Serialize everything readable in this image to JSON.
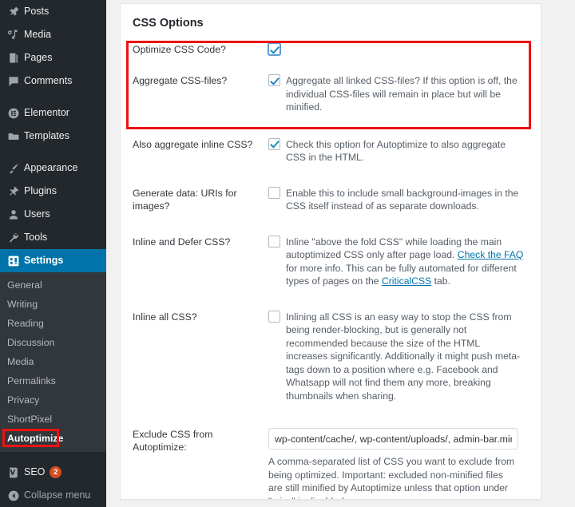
{
  "sidebar": {
    "items": [
      {
        "label": "Posts",
        "icon": "pin-icon"
      },
      {
        "label": "Media",
        "icon": "media-icon"
      },
      {
        "label": "Pages",
        "icon": "page-icon"
      },
      {
        "label": "Comments",
        "icon": "comment-icon"
      },
      {
        "label": "Elementor",
        "icon": "elementor-icon"
      },
      {
        "label": "Templates",
        "icon": "folder-icon"
      },
      {
        "label": "Appearance",
        "icon": "brush-icon"
      },
      {
        "label": "Plugins",
        "icon": "plug-icon"
      },
      {
        "label": "Users",
        "icon": "user-icon"
      },
      {
        "label": "Tools",
        "icon": "wrench-icon"
      },
      {
        "label": "Settings",
        "icon": "settings-icon"
      }
    ],
    "submenu": [
      "General",
      "Writing",
      "Reading",
      "Discussion",
      "Media",
      "Permalinks",
      "Privacy",
      "ShortPixel",
      "Autoptimize"
    ],
    "current_submenu": "Autoptimize",
    "active_item": "Settings",
    "seo": {
      "label": "SEO",
      "icon": "yoast-icon",
      "badge": "2"
    },
    "collapse": {
      "label": "Collapse menu",
      "icon": "collapse-arrow-icon"
    },
    "colors": {
      "background": "#23282d",
      "submenu_background": "#32373c",
      "active": "#0073aa",
      "badge": "#d54e21",
      "highlight": "#ee1111"
    }
  },
  "panel": {
    "title": "CSS Options",
    "rows": [
      {
        "label": "Optimize CSS Code?",
        "checked": true,
        "focused": true,
        "desc": ""
      },
      {
        "label": "Aggregate CSS-files?",
        "checked": true,
        "focused": false,
        "desc": "Aggregate all linked CSS-files? If this option is off, the individual CSS-files will remain in place but will be minified."
      },
      {
        "label": "Also aggregate inline CSS?",
        "checked": true,
        "focused": false,
        "desc": "Check this option for Autoptimize to also aggregate CSS in the HTML."
      },
      {
        "label": "Generate data: URIs for images?",
        "checked": false,
        "focused": false,
        "desc": "Enable this to include small background-images in the CSS itself instead of as separate downloads."
      },
      {
        "label": "Inline and Defer CSS?",
        "checked": false,
        "focused": false,
        "desc_part1": "Inline \"above the fold CSS\" while loading the main autoptimized CSS only after page load. ",
        "link1": "Check the FAQ",
        "desc_part2": " for more info. This can be fully automated for different types of pages on the ",
        "link2": "CriticalCSS",
        "desc_part3": " tab."
      },
      {
        "label": "Inline all CSS?",
        "checked": false,
        "focused": false,
        "desc": "Inlining all CSS is an easy way to stop the CSS from being render-blocking, but is generally not recommended because the size of the HTML increases significantly. Additionally it might push meta-tags down to a position where e.g. Facebook and Whatsapp will not find them any more, breaking thumbnails when sharing."
      }
    ],
    "exclude": {
      "label": "Exclude CSS from Autoptimize:",
      "value": "wp-content/cache/, wp-content/uploads/, admin-bar.min",
      "desc": "A comma-separated list of CSS you want to exclude from being optimized. Important: excluded non-minified files are still minified by Autoptimize unless that option under \"misc\" is disabled."
    }
  }
}
